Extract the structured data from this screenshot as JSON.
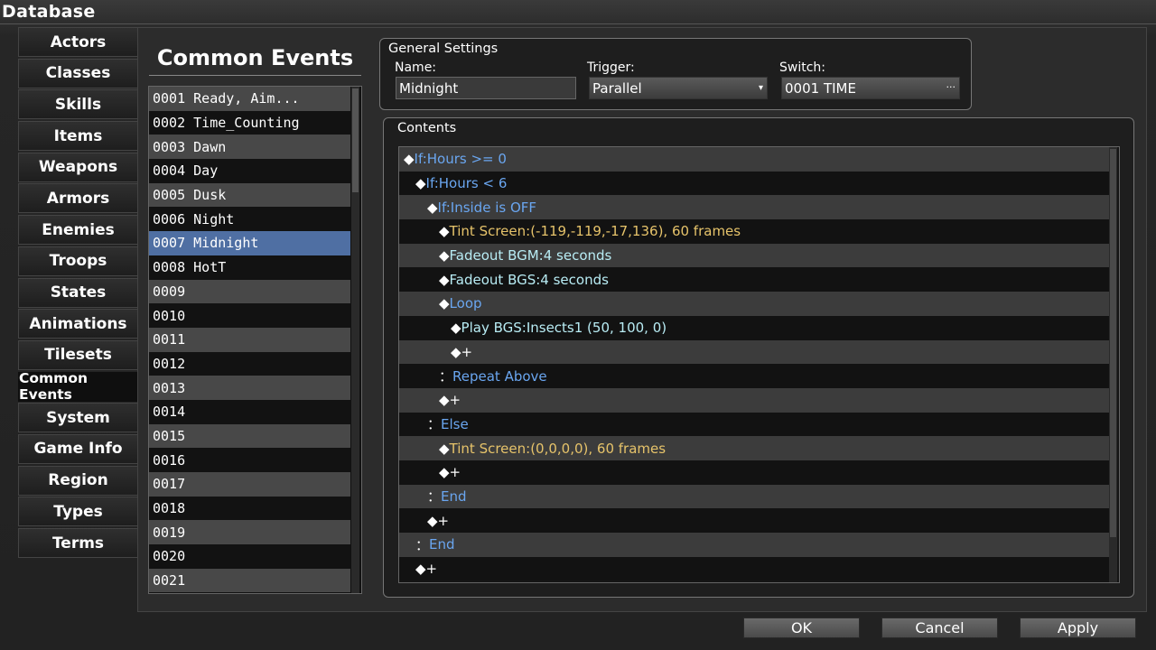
{
  "window": {
    "title": "Database"
  },
  "tabs": [
    {
      "label": "Actors"
    },
    {
      "label": "Classes"
    },
    {
      "label": "Skills"
    },
    {
      "label": "Items"
    },
    {
      "label": "Weapons"
    },
    {
      "label": "Armors"
    },
    {
      "label": "Enemies"
    },
    {
      "label": "Troops"
    },
    {
      "label": "States"
    },
    {
      "label": "Animations"
    },
    {
      "label": "Tilesets"
    },
    {
      "label": "Common Events",
      "active": true
    },
    {
      "label": "System"
    },
    {
      "label": "Game Info"
    },
    {
      "label": "Region"
    },
    {
      "label": "Types"
    },
    {
      "label": "Terms"
    }
  ],
  "common_events": {
    "title": "Common Events",
    "items": [
      "0001 Ready, Aim...",
      "0002 Time_Counting",
      "0003 Dawn",
      "0004 Day",
      "0005 Dusk",
      "0006 Night",
      "0007 Midnight",
      "0008 HotT",
      "0009",
      "0010",
      "0011",
      "0012",
      "0013",
      "0014",
      "0015",
      "0016",
      "0017",
      "0018",
      "0019",
      "0020",
      "0021"
    ],
    "selected_index": 6
  },
  "general_settings": {
    "label": "General Settings",
    "name_label": "Name:",
    "name_value": "Midnight",
    "trigger_label": "Trigger:",
    "trigger_value": "Parallel",
    "switch_label": "Switch:",
    "switch_value": "0001 TIME"
  },
  "contents": {
    "label": "Contents",
    "commands": [
      {
        "indent": 0,
        "prefix": "◆",
        "text": "If:Hours >= 0",
        "color": "blue"
      },
      {
        "indent": 1,
        "prefix": "◆",
        "text": "If:Hours < 6",
        "color": "blue"
      },
      {
        "indent": 2,
        "prefix": "◆",
        "text": "If:Inside is OFF",
        "color": "blue"
      },
      {
        "indent": 3,
        "prefix": "◆",
        "text": "Tint Screen:(-119,-119,-17,136), 60 frames",
        "color": "yellow"
      },
      {
        "indent": 3,
        "prefix": "◆",
        "text": "Fadeout BGM:4 seconds",
        "color": "cyan"
      },
      {
        "indent": 3,
        "prefix": "◆",
        "text": "Fadeout BGS:4 seconds",
        "color": "cyan"
      },
      {
        "indent": 3,
        "prefix": "◆",
        "text": "Loop",
        "color": "blue"
      },
      {
        "indent": 4,
        "prefix": "◆",
        "text": "Play BGS:Insects1 (50, 100, 0)",
        "color": "cyan"
      },
      {
        "indent": 4,
        "prefix": "◆",
        "text": "+",
        "color": "white"
      },
      {
        "indent": 3,
        "prefix": "：",
        "text": "Repeat Above",
        "color": "blue"
      },
      {
        "indent": 3,
        "prefix": "◆",
        "text": "+",
        "color": "white"
      },
      {
        "indent": 2,
        "prefix": "：",
        "text": "Else",
        "color": "blue"
      },
      {
        "indent": 3,
        "prefix": "◆",
        "text": "Tint Screen:(0,0,0,0), 60 frames",
        "color": "yellow"
      },
      {
        "indent": 3,
        "prefix": "◆",
        "text": "+",
        "color": "white"
      },
      {
        "indent": 2,
        "prefix": "：",
        "text": "End",
        "color": "blue"
      },
      {
        "indent": 2,
        "prefix": "◆",
        "text": "+",
        "color": "white"
      },
      {
        "indent": 1,
        "prefix": "：",
        "text": "End",
        "color": "blue"
      },
      {
        "indent": 1,
        "prefix": "◆",
        "text": "+",
        "color": "white"
      }
    ]
  },
  "buttons": {
    "ok": "OK",
    "cancel": "Cancel",
    "apply": "Apply"
  },
  "colors": {
    "selection": "#4f6fa3",
    "command_blue": "#6aa6f0",
    "command_yellow": "#e6c36a",
    "command_cyan": "#b8ecf4"
  }
}
